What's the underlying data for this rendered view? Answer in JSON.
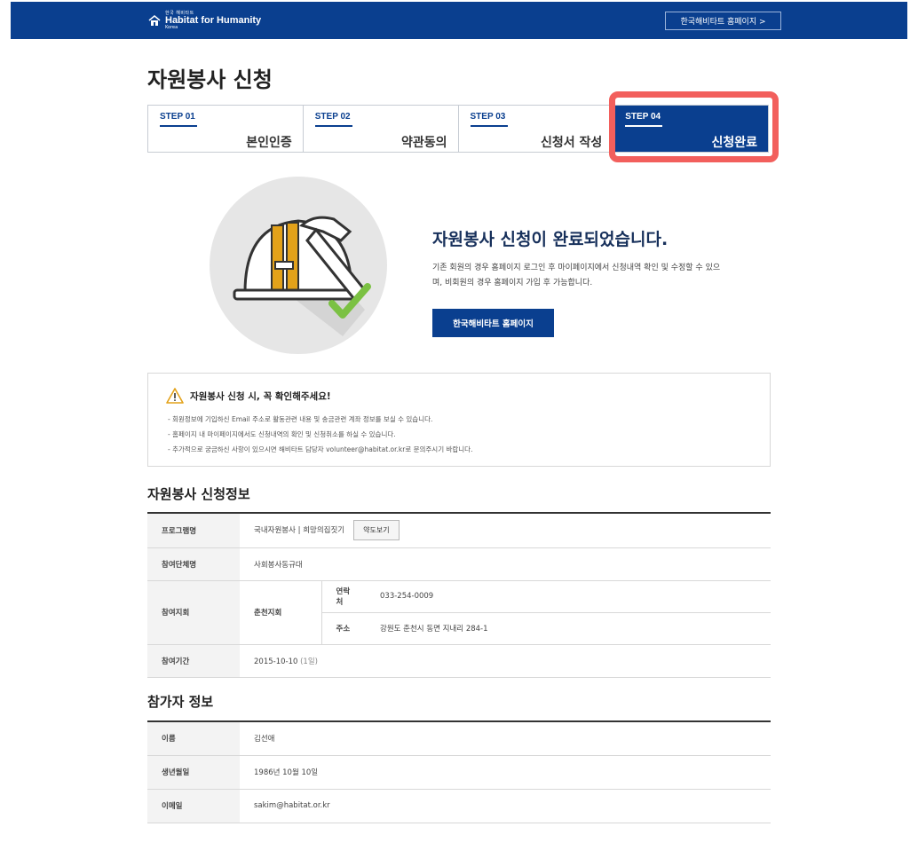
{
  "header": {
    "logo_small": "한국 해비타트",
    "logo_main": "Habitat for Humanity",
    "logo_korea": "Korea",
    "home_link": "한국해비타트 홈페이지 >"
  },
  "page_title": "자원봉사 신청",
  "steps": [
    {
      "num": "STEP 01",
      "label": "본인인증"
    },
    {
      "num": "STEP 02",
      "label": "약관동의"
    },
    {
      "num": "STEP 03",
      "label": "신청서 작성"
    },
    {
      "num": "STEP 04",
      "label": "신청완료"
    }
  ],
  "complete": {
    "title": "자원봉사 신청이 완료되었습니다.",
    "desc": "기존 회원의 경우 홈페이지 로그인 후 마이페이지에서 신청내역 확인 및 수정할 수 있으며, 비회원의 경우 홈페이지 가입 후 가능합니다.",
    "button": "한국해비타트 홈페이지"
  },
  "notice": {
    "title": "자원봉사 신청 시, 꼭 확인해주세요!",
    "items": [
      "- 회원정보에 기입하신 Email 주소로 활동관련 내용 및 송금관련 계좌 정보를 보실 수 있습니다.",
      "- 홈페이지 내 마이페이지에서도 신청내역의 확인 및 신청취소를 하실 수 있습니다.",
      "- 추가적으로 궁금하신 사항이 있으시면 해비타트 담당자 volunteer@habitat.or.kr로 문의주시기 바랍니다."
    ]
  },
  "application": {
    "title": "자원봉사 신청정보",
    "program_label": "프로그램명",
    "program_value": "국내자원봉사 | 희망의집짓기",
    "map_button": "약도보기",
    "group_label": "참여단체명",
    "group_value": "사회봉사동규대",
    "branch_label": "참여지회",
    "branch_value": "춘천지회",
    "contact_label": "연락처",
    "contact_value": "033-254-0009",
    "address_label": "주소",
    "address_value": "강원도 춘천시 동면 지내리 284-1",
    "period_label": "참여기간",
    "period_value": "2015-10-10",
    "period_days": "(1일)"
  },
  "participant": {
    "title": "참가자 정보",
    "name_label": "이름",
    "name_value": "김선애",
    "birth_label": "생년월일",
    "birth_value": "1986년 10월 10일",
    "email_label": "이메일",
    "email_value": "sakim@habitat.or.kr"
  },
  "colors": {
    "brand": "#0a3f8f",
    "highlight": "#f25f5c",
    "check": "#7bc143",
    "helmet_stripe": "#e3a21a"
  },
  "icons": {
    "logo": "habitat-house-logo",
    "illustration": "helmet-hammer-check",
    "notice": "warning-triangle-icon"
  }
}
